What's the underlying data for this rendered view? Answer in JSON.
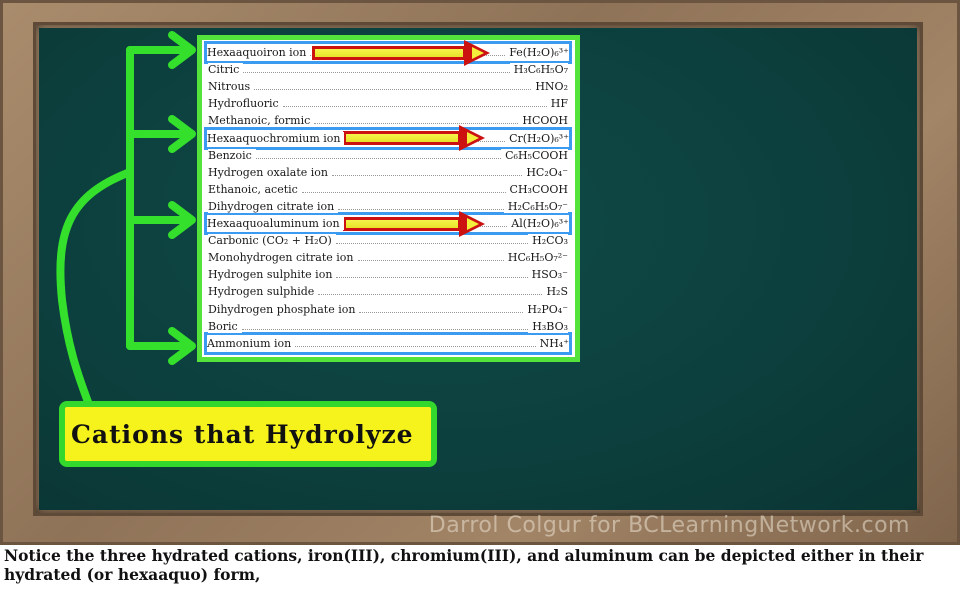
{
  "slide": {
    "watermark": "Darrol Colgur for BCLearningNetwork.com",
    "label": "Cations that Hydrolyze",
    "caption": "Notice the three hydrated cations, iron(III), chromium(III), and aluminum can be depicted either in their hydrated (or hexaaquo) form,"
  },
  "table": {
    "rows": [
      {
        "name": "Hexaaquoiron ion",
        "formula": "Fe(H₂O)₆³⁺",
        "highlight": true
      },
      {
        "name": "Citric",
        "formula": "H₃C₆H₅O₇",
        "highlight": false
      },
      {
        "name": "Nitrous",
        "formula": "HNO₂",
        "highlight": false
      },
      {
        "name": "Hydrofluoric",
        "formula": "HF",
        "highlight": false
      },
      {
        "name": "Methanoic, formic",
        "formula": "HCOOH",
        "highlight": false
      },
      {
        "name": "Hexaaquochromium ion",
        "formula": "Cr(H₂O)₆³⁺",
        "highlight": true
      },
      {
        "name": "Benzoic",
        "formula": "C₆H₅COOH",
        "highlight": false
      },
      {
        "name": "Hydrogen oxalate ion",
        "formula": "HC₂O₄⁻",
        "highlight": false
      },
      {
        "name": "Ethanoic, acetic",
        "formula": "CH₃COOH",
        "highlight": false
      },
      {
        "name": "Dihydrogen citrate ion",
        "formula": "H₂C₆H₅O₇⁻",
        "highlight": false
      },
      {
        "name": "Hexaaquoaluminum ion",
        "formula": "Al(H₂O)₆³⁺",
        "highlight": true
      },
      {
        "name": "Carbonic (CO₂ + H₂O)",
        "formula": "H₂CO₃",
        "highlight": false
      },
      {
        "name": "Monohydrogen citrate ion",
        "formula": "HC₆H₅O₇²⁻",
        "highlight": false
      },
      {
        "name": "Hydrogen sulphite ion",
        "formula": "HSO₃⁻",
        "highlight": false
      },
      {
        "name": "Hydrogen sulphide",
        "formula": "H₂S",
        "highlight": false
      },
      {
        "name": "Dihydrogen phosphate ion",
        "formula": "H₂PO₄⁻",
        "highlight": false
      },
      {
        "name": "Boric",
        "formula": "H₃BO₃",
        "highlight": false
      },
      {
        "name": "Ammonium ion",
        "formula": "NH₄⁺",
        "highlight": true
      }
    ]
  },
  "colors": {
    "board": "#0c3f3d",
    "frame": "#9a7d60",
    "highlight_outline": "#3a9bf0",
    "connector_green": "#34e02c",
    "label_fill": "#f6f31c",
    "arrow_outline": "#cc1111"
  }
}
